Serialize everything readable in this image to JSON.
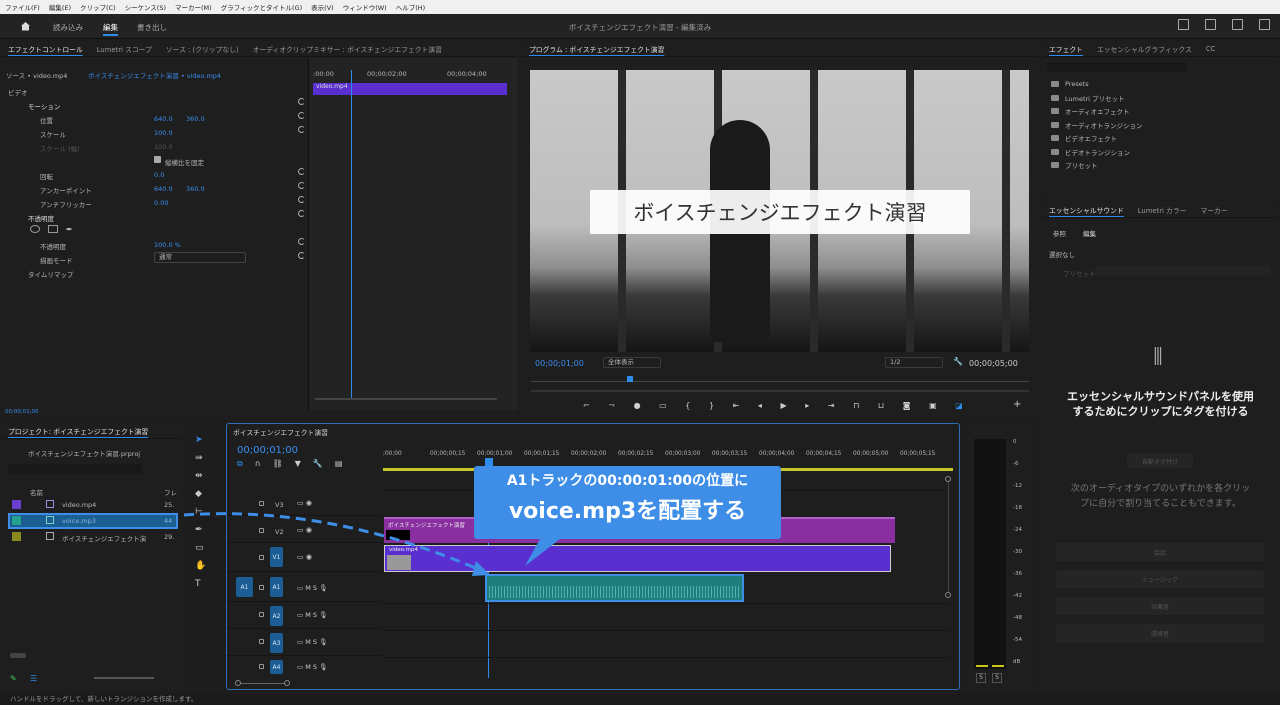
{
  "menu": [
    "ファイル(F)",
    "編集(E)",
    "クリップ(C)",
    "シーケンス(S)",
    "マーカー(M)",
    "グラフィックとタイトル(G)",
    "表示(V)",
    "ウィンドウ(W)",
    "ヘルプ(H)"
  ],
  "workspace": {
    "tabs": [
      "読み込み",
      "編集",
      "書き出し"
    ],
    "title": "ボイスチェンジエフェクト演習 - 編集済み"
  },
  "effect_controls": {
    "tabs": [
      "エフェクトコントロール",
      "Lumetri スコープ",
      "ソース : (クリップなし)",
      "オーディオクリップミキサー : ボイスチェンジエフェクト演習"
    ],
    "source": "ソース • video.mp4",
    "seq": "ボイスチェンジエフェクト演習 • video.mp4",
    "times": [
      ":00:00",
      "00;00;02;00",
      "00;00;04;00"
    ],
    "clip": "video.mp4",
    "video": "ビデオ",
    "motion": "モーション",
    "position": "位置",
    "pos_x": "640.0",
    "pos_y": "360.0",
    "scale": "スケール",
    "scale_v": "100.0",
    "scale_w": "スケール (幅)",
    "scale_w_v": "100.0",
    "uniform": "縦横比を固定",
    "rotation": "回転",
    "rot_v": "0.0",
    "anchor": "アンカーポイント",
    "anc_x": "640.0",
    "anc_y": "360.0",
    "anti": "アンチフリッカー",
    "anti_v": "0.00",
    "opacity": "不透明度",
    "opacity_p": "不透明度",
    "opacity_v": "100.0 %",
    "blend": "描画モード",
    "blend_v": "通常",
    "remap": "タイムリマップ",
    "timecode": "00;00;01;00"
  },
  "program": {
    "title": "プログラム : ボイスチェンジエフェクト演習",
    "overlay": "ボイスチェンジエフェクト演習",
    "time": "00;00;01;00",
    "fit": "全体表示",
    "res": "1/2",
    "duration": "00;00;05;00"
  },
  "effects_panel": {
    "tabs": [
      "エフェクト",
      "エッセンシャルグラフィックス",
      "CC"
    ],
    "folders": [
      "Presets",
      "Lumetri プリセット",
      "オーディオエフェクト",
      "オーディオトランジション",
      "ビデオエフェクト",
      "ビデオトランジション",
      "プリセット"
    ]
  },
  "essential_sound": {
    "tabs": [
      "エッセンシャルサウンド",
      "Lumetri カラー",
      "マーカー"
    ],
    "subtabs": [
      "参照",
      "編集"
    ],
    "none": "選択なし",
    "preset": "プリセット",
    "msg1": "エッセンシャルサウンドパネルを使用",
    "msg2": "するためにクリップにタグを付ける",
    "auto": "自動タグ付け",
    "desc1": "次のオーディオタイプのいずれかを各クリッ",
    "desc2": "プに自分で割り当てることもできます。",
    "buttons": [
      "会話",
      "ミュージック",
      "効果音",
      "環境音"
    ]
  },
  "project": {
    "title": "プロジェクト: ボイスチェンジエフェクト演習",
    "file": "ボイスチェンジエフェクト演習.prproj",
    "col_name": "名前",
    "col_fps": "フレ",
    "items": [
      {
        "name": "video.mp4",
        "fps": "25.",
        "color": "#6a3fcf"
      },
      {
        "name": "voice.mp3",
        "fps": "44",
        "color": "#27a18f"
      },
      {
        "name": "ボイスチェンジエフェクト演",
        "fps": "29.",
        "color": "#8a8a1e"
      }
    ]
  },
  "timeline": {
    "title": "ボイスチェンジエフェクト演習",
    "timecode": "00;00;01;00",
    "ruler": [
      ";00;00",
      "00;00;00;15",
      "00;00;01;00",
      "00;00;01;15",
      "00;00;02;00",
      "00;00;02;15",
      "00;00;03;00",
      "00;00;03;15",
      "00;00;04;00",
      "00;00;04;15",
      "00;00;05;00",
      "00;00;05;15"
    ],
    "tracks_v": [
      "V3",
      "V2",
      "V1"
    ],
    "tracks_a": [
      "A1",
      "A2",
      "A3",
      "A4"
    ],
    "src": "A1",
    "clip_v2": "ボイスチェンジエフェクト演習",
    "clip_v1": "video.mp4"
  },
  "meter": {
    "ticks": [
      "0",
      "-6",
      "-12",
      "-18",
      "-24",
      "-30",
      "-36",
      "-42",
      "-48",
      "-54",
      "dB"
    ],
    "s": "S"
  },
  "callout": {
    "line1": "A1トラックの00:00:01:00の位置に",
    "line2": "voice.mp3を配置する"
  },
  "status": "ハンドルをドラッグして、新しいトランジションを作成します。",
  "colors": {
    "accent": "#2d8ceb",
    "video_clip": "#5a2fd0",
    "graphic_clip": "#8a2fa0",
    "audio_clip": "#1f7d7d"
  }
}
